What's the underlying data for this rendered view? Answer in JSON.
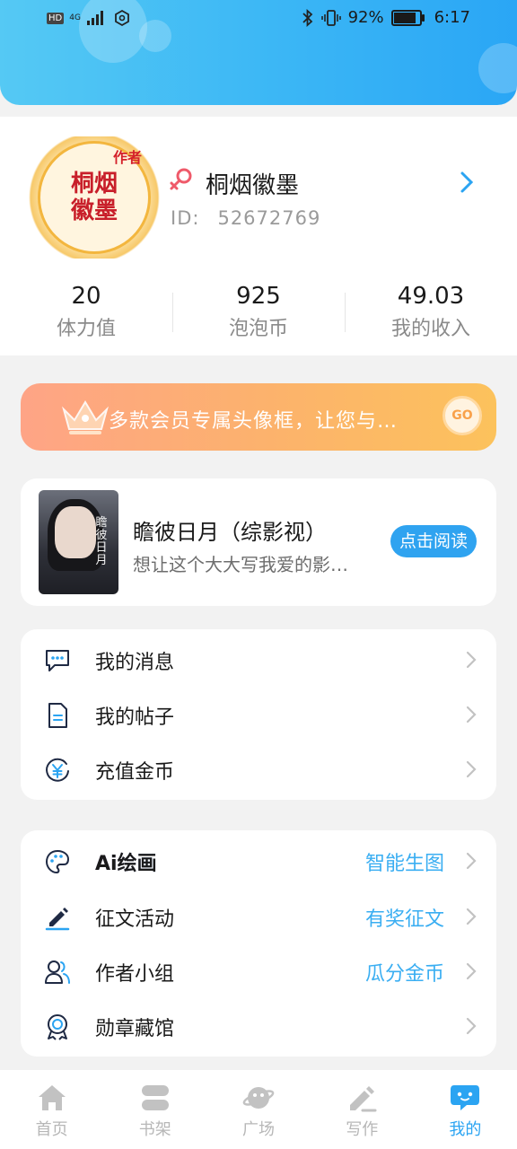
{
  "status_bar": {
    "network_badge": "HD",
    "network_type": "4G",
    "battery": "92%",
    "battery_level": 0.92,
    "time": "6:17"
  },
  "colors": {
    "header_gradient": [
      "#55c9f4",
      "#2aa6f5"
    ],
    "accent": "#2ba4f2",
    "banner_gradient": [
      "#fea486",
      "#fcc25c"
    ],
    "gender_icon": "#ef5a6a"
  },
  "profile": {
    "avatar_badge": "作者",
    "avatar_signature": "桐烟徽墨",
    "gender_icon": "female-icon",
    "name": "桐烟徽墨",
    "id_label": "ID:",
    "id_value": "52672769"
  },
  "stats": [
    {
      "value": "20",
      "label": "体力值"
    },
    {
      "value": "925",
      "label": "泡泡币"
    },
    {
      "value": "49.03",
      "label": "我的收入"
    }
  ],
  "banner": {
    "text": "多款会员专属头像框，让您与…",
    "go_label": "GO"
  },
  "book": {
    "cover_text": "瞻彼日月",
    "title": "瞻彼日月（综影视）",
    "description": "想让这个大大写我爱的影…",
    "read_button": "点击阅读"
  },
  "menu1": [
    {
      "icon": "message-icon",
      "label": "我的消息"
    },
    {
      "icon": "document-icon",
      "label": "我的帖子"
    },
    {
      "icon": "coin-icon",
      "label": "充值金币"
    }
  ],
  "menu2": [
    {
      "icon": "palette-icon",
      "label": "Ai绘画",
      "right": "智能生图"
    },
    {
      "icon": "pen-icon",
      "label": "征文活动",
      "right": "有奖征文"
    },
    {
      "icon": "group-icon",
      "label": "作者小组",
      "right": "瓜分金币"
    },
    {
      "icon": "medal-icon",
      "label": "勋章藏馆",
      "right": ""
    }
  ],
  "tabs": [
    {
      "icon": "home-icon",
      "label": "首页"
    },
    {
      "icon": "bookshelf-icon",
      "label": "书架"
    },
    {
      "icon": "planet-icon",
      "label": "广场"
    },
    {
      "icon": "write-icon",
      "label": "写作"
    },
    {
      "icon": "chat-bubble-icon",
      "label": "我的",
      "active": true
    }
  ]
}
